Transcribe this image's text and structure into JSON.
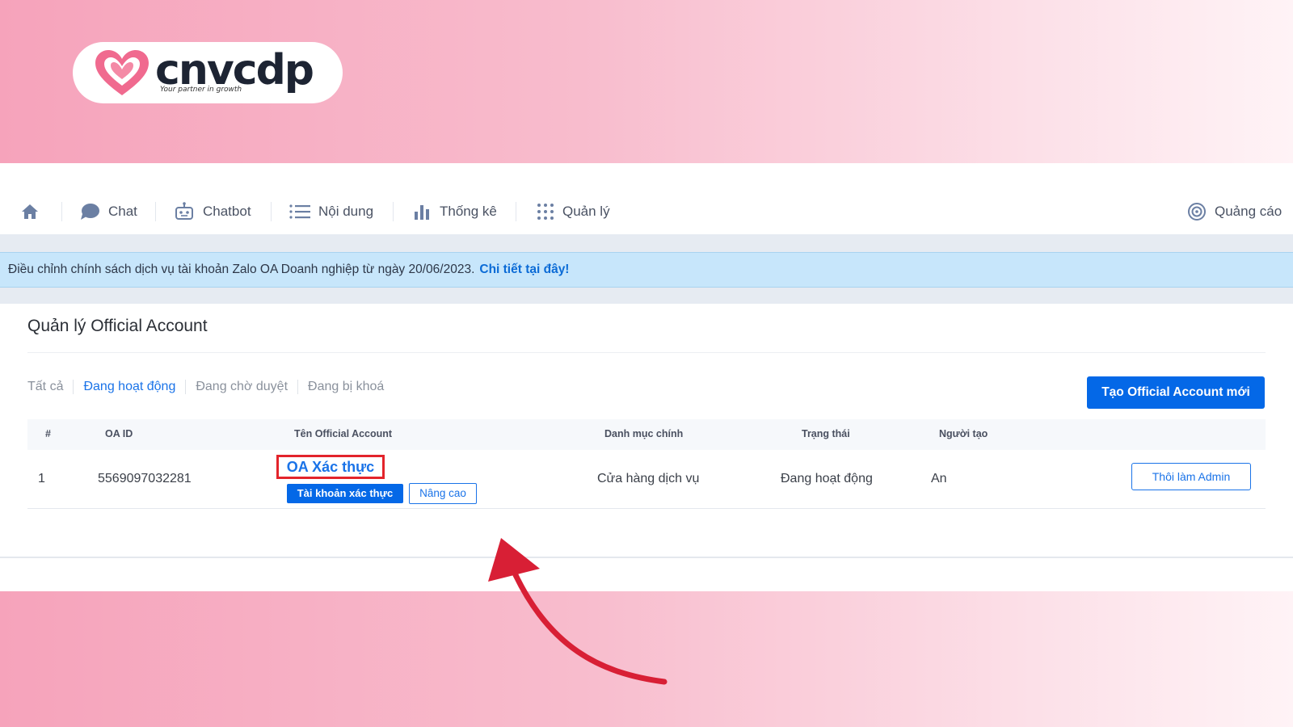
{
  "branding": {
    "logo_text": "cnvcdp",
    "tagline": "Your partner in growth",
    "heart_color": "#f06a8f"
  },
  "nav": {
    "items": [
      {
        "label": "",
        "icon": "home-icon"
      },
      {
        "label": "Chat",
        "icon": "chat-bubble-icon"
      },
      {
        "label": "Chatbot",
        "icon": "robot-icon"
      },
      {
        "label": "Nội dung",
        "icon": "list-icon"
      },
      {
        "label": "Thống kê",
        "icon": "bar-chart-icon"
      },
      {
        "label": "Quản lý",
        "icon": "grid-icon"
      }
    ],
    "ads": {
      "label": "Quảng cáo",
      "icon": "target-icon"
    }
  },
  "notice": {
    "text": "Điều chỉnh chính sách dịch vụ tài khoản Zalo OA Doanh nghiệp từ ngày 20/06/2023.",
    "link": "Chi tiết tại đây!"
  },
  "page": {
    "title": "Quản lý Official Account",
    "filters": [
      {
        "label": "Tất cả",
        "active": false
      },
      {
        "label": "Đang hoạt động",
        "active": true
      },
      {
        "label": "Đang chờ duyệt",
        "active": false
      },
      {
        "label": "Đang bị khoá",
        "active": false
      }
    ],
    "create_button": "Tạo Official Account mới"
  },
  "table": {
    "headers": [
      "#",
      "OA ID",
      "Tên Official Account",
      "Danh mục chính",
      "Trạng thái",
      "Người tạo"
    ],
    "rows": [
      {
        "index": "1",
        "oa_id": "5569097032281",
        "name": "OA Xác thực",
        "badge_verified": "Tài khoản xác thực",
        "badge_advanced": "Nâng cao",
        "category": "Cửa hàng dịch vụ",
        "status": "Đang hoạt động",
        "creator": "An",
        "action": "Thôi làm Admin"
      }
    ]
  },
  "colors": {
    "accent": "#0468e7",
    "highlight": "#e3242b",
    "annotation_arrow": "#d81f35"
  }
}
